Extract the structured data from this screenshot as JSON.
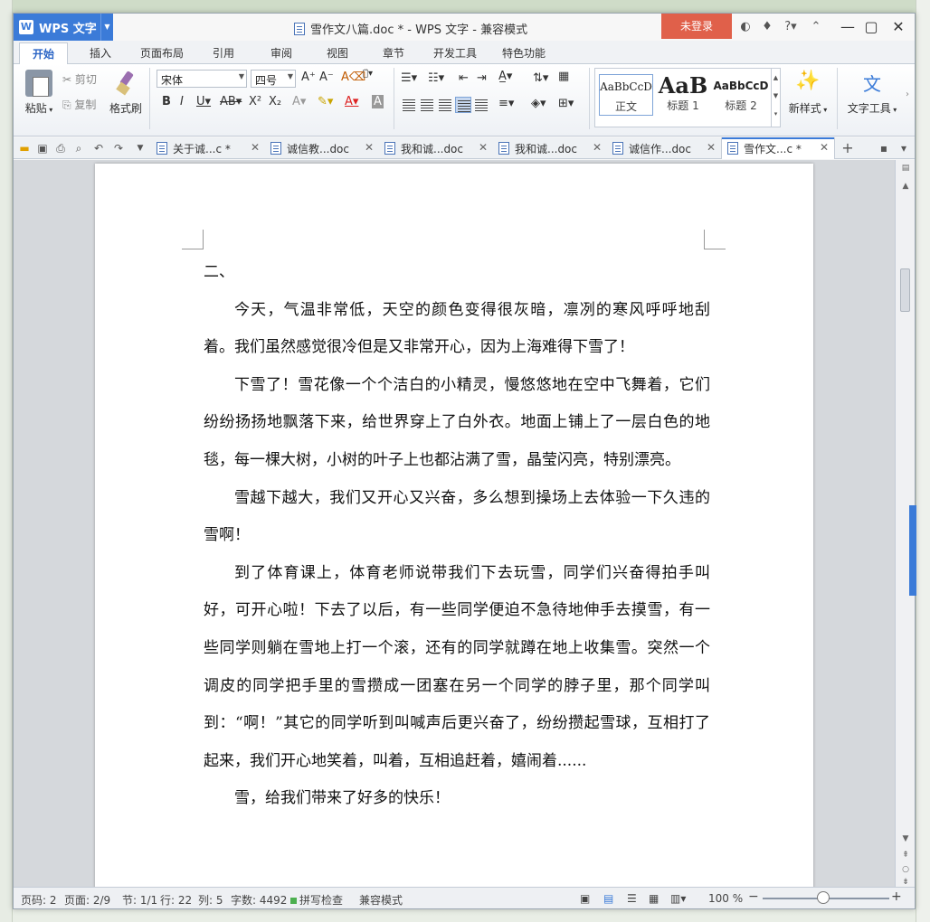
{
  "app": {
    "menu_label": "WPS 文字",
    "title": "雪作文八篇.doc * - WPS 文字 - 兼容模式",
    "login": "未登录"
  },
  "ribbon_tabs": [
    "开始",
    "插入",
    "页面布局",
    "引用",
    "审阅",
    "视图",
    "章节",
    "开发工具",
    "特色功能"
  ],
  "ribbon": {
    "paste": "粘贴",
    "cut": "剪切",
    "copy": "复制",
    "format_painter": "格式刷",
    "font_name": "宋体",
    "font_size": "四号",
    "styles": [
      {
        "preview": "AaBbCcD",
        "label": "正文"
      },
      {
        "preview": "AaB",
        "label": "标题 1"
      },
      {
        "preview": "AaBbCcD",
        "label": "标题 2"
      }
    ],
    "new_style": "新样式",
    "text_tools": "文字工具"
  },
  "doc_tabs": [
    {
      "label": "关于诚...c *"
    },
    {
      "label": "诚信教...doc"
    },
    {
      "label": "我和诚...doc"
    },
    {
      "label": "我和诚...doc"
    },
    {
      "label": "诚信作...doc"
    },
    {
      "label": "雪作文...c *"
    }
  ],
  "document": {
    "heading": "二、",
    "paragraphs": [
      "今天，气温非常低，天空的颜色变得很灰暗，凛冽的寒风呼呼地刮着。我们虽然感觉很冷但是又非常开心，因为上海难得下雪了！",
      "下雪了！雪花像一个个洁白的小精灵，慢悠悠地在空中飞舞着，它们纷纷扬扬地飘落下来，给世界穿上了白外衣。地面上铺上了一层白色的地毯，每一棵大树，小树的叶子上也都沾满了雪，晶莹闪亮，特别漂亮。",
      "雪越下越大，我们又开心又兴奋，多么想到操场上去体验一下久违的雪啊！",
      "到了体育课上，体育老师说带我们下去玩雪，同学们兴奋得拍手叫好，可开心啦！下去了以后，有一些同学便迫不急待地伸手去摸雪，有一些同学则躺在雪地上打一个滚，还有的同学就蹲在地上收集雪。突然一个调皮的同学把手里的雪攒成一团塞在另一个同学的脖子里，那个同学叫到：“啊！”其它的同学听到叫喊声后更兴奋了，纷纷攒起雪球，互相打了起来，我们开心地笑着，叫着，互相追赶着，嬉闹着......",
      "雪，给我们带来了好多的快乐！"
    ]
  },
  "status": {
    "page_code": "页码: 2",
    "page": "页面: 2/9",
    "section": "节: 1/1",
    "row": "行: 22",
    "col": "列: 5",
    "word_count": "字数: 4492",
    "spell_check": "拼写检查",
    "compat_mode": "兼容模式",
    "zoom": "100 %"
  },
  "colors": {
    "accent": "#3b7bd8",
    "login_bg": "#e0604a"
  }
}
